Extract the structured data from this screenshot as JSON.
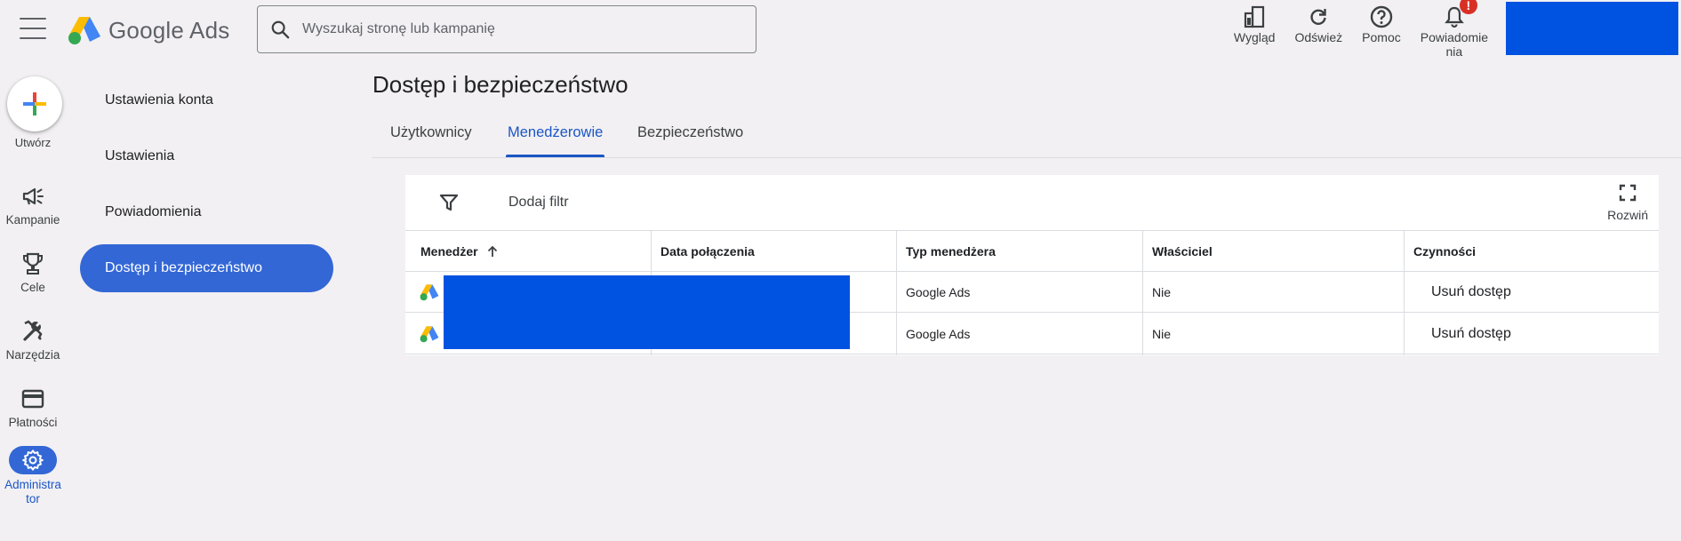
{
  "app": {
    "name_google": "Google",
    "name_ads": "Ads"
  },
  "search": {
    "placeholder": "Wyszukaj stronę lub kampanię"
  },
  "top_actions": [
    {
      "label": "Wygląd",
      "icon": "appearance-icon"
    },
    {
      "label": "Odśwież",
      "icon": "refresh-icon"
    },
    {
      "label": "Pomoc",
      "icon": "help-icon"
    },
    {
      "label": "Powiadomienia",
      "label_line1": "Powiadomie",
      "label_line2": "nia",
      "icon": "bell-icon",
      "badge": "!"
    }
  ],
  "rail": {
    "create_label": "Utwórz",
    "items": [
      {
        "label": "Kampanie",
        "icon": "megaphone-icon"
      },
      {
        "label": "Cele",
        "icon": "trophy-icon"
      },
      {
        "label": "Narzędzia",
        "icon": "tools-icon"
      },
      {
        "label": "Płatności",
        "icon": "credit-card-icon"
      },
      {
        "label_line1": "Administra",
        "label_line2": "tor",
        "label": "Administrator",
        "icon": "gear-icon",
        "active": true
      }
    ]
  },
  "subnav": {
    "items": [
      {
        "label": "Ustawienia konta"
      },
      {
        "label": "Ustawienia"
      },
      {
        "label": "Powiadomienia"
      },
      {
        "label": "Dostęp i bezpieczeństwo",
        "active": true
      }
    ]
  },
  "page": {
    "title": "Dostęp i bezpieczeństwo",
    "tabs": [
      {
        "label": "Użytkownicy"
      },
      {
        "label": "Menedżerowie",
        "active": true
      },
      {
        "label": "Bezpieczeństwo"
      }
    ]
  },
  "table": {
    "add_filter_label": "Dodaj filtr",
    "expand_label": "Rozwiń",
    "columns": [
      "Menedżer",
      "Data połączenia",
      "Typ menedżera",
      "Właściciel",
      "Czynności"
    ],
    "rows": [
      {
        "manager": "",
        "date": "",
        "type": "Google Ads",
        "owner": "Nie",
        "action": "Usuń dostęp"
      },
      {
        "manager": "",
        "date": "",
        "type": "Google Ads",
        "owner": "Nie",
        "action": "Usuń dostęp"
      }
    ]
  },
  "colors": {
    "accent": "#1a56c6",
    "active_pill": "#3367d6",
    "redaction": "#0052e0",
    "background": "#f2f0f3",
    "alert": "#d93025"
  }
}
